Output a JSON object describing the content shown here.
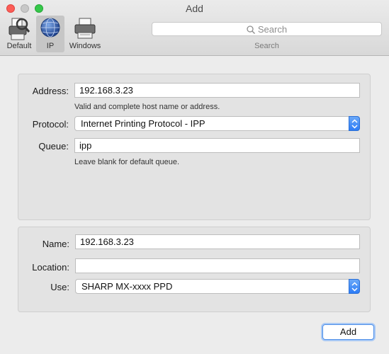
{
  "window": {
    "title": "Add"
  },
  "toolbar": {
    "items": [
      {
        "label": "Default",
        "icon": "default-printer-icon"
      },
      {
        "label": "IP",
        "icon": "globe-icon",
        "selected": true
      },
      {
        "label": "Windows",
        "icon": "windows-printer-icon"
      }
    ],
    "search": {
      "placeholder": "Search",
      "label": "Search"
    }
  },
  "connection": {
    "address_label": "Address:",
    "address_value": "192.168.3.23",
    "address_hint": "Valid and complete host name or address.",
    "protocol_label": "Protocol:",
    "protocol_value": "Internet Printing Protocol - IPP",
    "queue_label": "Queue:",
    "queue_value": "ipp",
    "queue_hint": "Leave blank for default queue."
  },
  "details": {
    "name_label": "Name:",
    "name_value": "192.168.3.23",
    "location_label": "Location:",
    "location_value": "",
    "use_label": "Use:",
    "use_value": "SHARP MX-xxxx PPD"
  },
  "footer": {
    "add_label": "Add"
  },
  "colors": {
    "accent": "#2d7cf6",
    "close": "#fc5d57",
    "maximize": "#35c84a"
  }
}
